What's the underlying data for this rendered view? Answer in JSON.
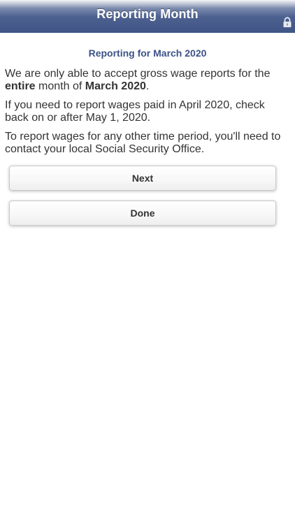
{
  "header": {
    "title": "Reporting Month",
    "lock_icon": "lock-icon"
  },
  "main": {
    "subtitle": "Reporting for March 2020",
    "paragraph1": {
      "part1": "We are only able to accept gross wage reports for the ",
      "bold1": "entire",
      "part2": " month of ",
      "bold2": "March 2020",
      "part3": "."
    },
    "paragraph2": "If you need to report wages paid in April 2020, check back on or after May 1, 2020.",
    "paragraph3": "To report wages for any other time period, you'll need to contact your local Social Security Office."
  },
  "buttons": {
    "next_label": "Next",
    "done_label": "Done"
  },
  "colors": {
    "header_bg": "#3f5585",
    "subtitle_text": "#3c5287",
    "body_text": "#333333"
  }
}
